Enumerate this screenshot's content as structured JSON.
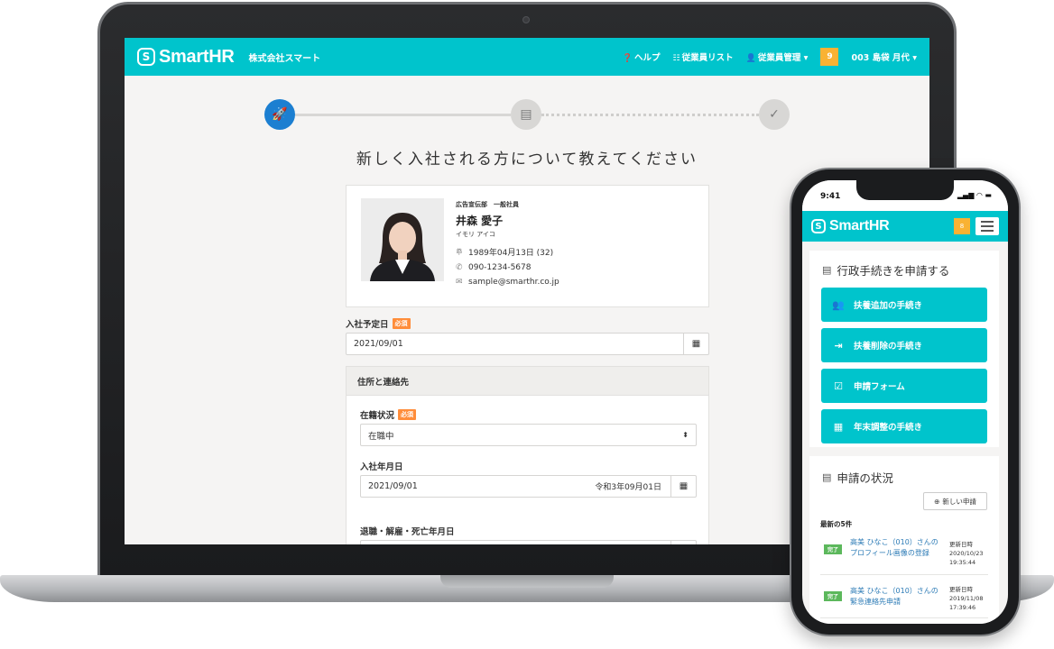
{
  "desktop": {
    "logo": "SmartHR",
    "company": "株式会社スマート",
    "nav": {
      "help": "ヘルプ",
      "employee_list": "従業員リスト",
      "employee_mgmt": "従業員管理",
      "badge": "9",
      "user": "003 島袋 月代"
    },
    "heading": "新しく入社される方について教えてください",
    "profile": {
      "department": "広告宣伝部　一般社員",
      "name": "井森 愛子",
      "kana": "イモリ アイコ",
      "birthday": "1989年04月13日 (32)",
      "phone": "090-1234-5678",
      "email": "sample@smarthr.co.jp"
    },
    "form": {
      "join_date_label": "入社予定日",
      "required": "必須",
      "join_date_value": "2021/09/01",
      "section_title": "住所と連絡先",
      "status_label": "在籍状況",
      "status_value": "在職中",
      "hire_date_label": "入社年月日",
      "hire_date_value": "2021/09/01",
      "hire_date_era": "令和3年09月01日",
      "retire_label": "退職・解雇・死亡年月日"
    }
  },
  "mobile": {
    "time": "9:41",
    "logo": "SmartHR",
    "badge": "8",
    "procedures_title": "行政手続きを申請する",
    "buttons": [
      {
        "label": "扶養追加の手続き",
        "icon": "people-icon"
      },
      {
        "label": "扶養削除の手続き",
        "icon": "exit-icon"
      },
      {
        "label": "申請フォーム",
        "icon": "form-check-icon"
      },
      {
        "label": "年末調整の手続き",
        "icon": "calendar-check-icon"
      }
    ],
    "status_title": "申請の状況",
    "new_request": "新しい申請",
    "latest": "最新の5件",
    "requests": [
      {
        "badge": "完了",
        "title": "高美 ひなこ（010）さんのプロフィール画像の登録",
        "updated_label": "更新日時",
        "date": "2020/10/23",
        "time": "19:35:44"
      },
      {
        "badge": "完了",
        "title": "高美 ひなこ（010）さんの緊急連絡先申請",
        "updated_label": "更新日時",
        "date": "2019/11/08",
        "time": "17:39:46"
      }
    ]
  },
  "colors": {
    "brand": "#00c4cc",
    "step_active": "#1c7fd1",
    "required": "#ff8d3a",
    "badge": "#f9b233",
    "done": "#5cb85c"
  }
}
